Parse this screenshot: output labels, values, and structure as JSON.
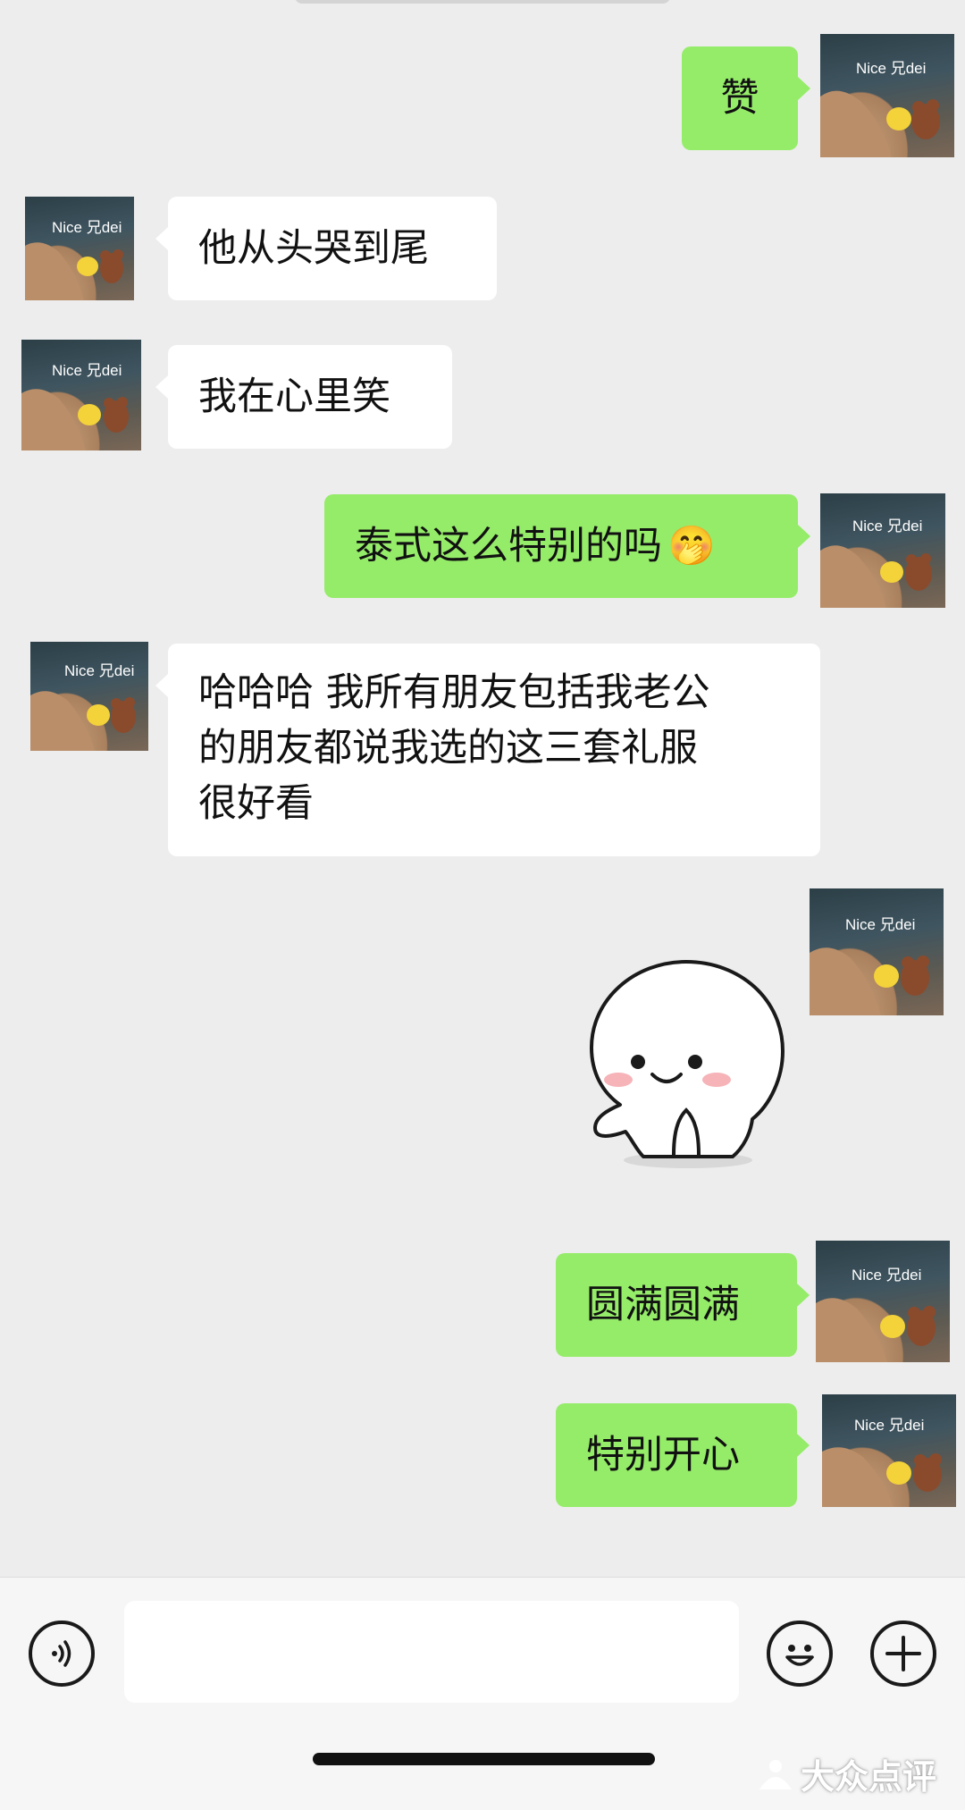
{
  "messages": [
    {
      "direction": "out",
      "text": "赞"
    },
    {
      "direction": "in",
      "text": "他从头哭到尾"
    },
    {
      "direction": "in",
      "text": "我在心里笑"
    },
    {
      "direction": "out",
      "text": "泰式这么特别的吗",
      "emoji": "🤭"
    },
    {
      "direction": "in",
      "lines": [
        "哈哈哈 我所有朋友包括我老公",
        "的朋友都说我选的这三套礼服",
        "很好看"
      ]
    },
    {
      "direction": "out",
      "sticker": "smiling-dumpling-sticker"
    },
    {
      "direction": "out",
      "text": "圆满圆满"
    },
    {
      "direction": "out",
      "text": "特别开心"
    }
  ],
  "avatar": {
    "text": "Nice 兄dei"
  },
  "input_bar": {
    "placeholder": ""
  },
  "watermark": {
    "text": "大众点评"
  },
  "colors": {
    "background": "#ededed",
    "outgoing_bubble": "#95ec69",
    "incoming_bubble": "#ffffff"
  }
}
